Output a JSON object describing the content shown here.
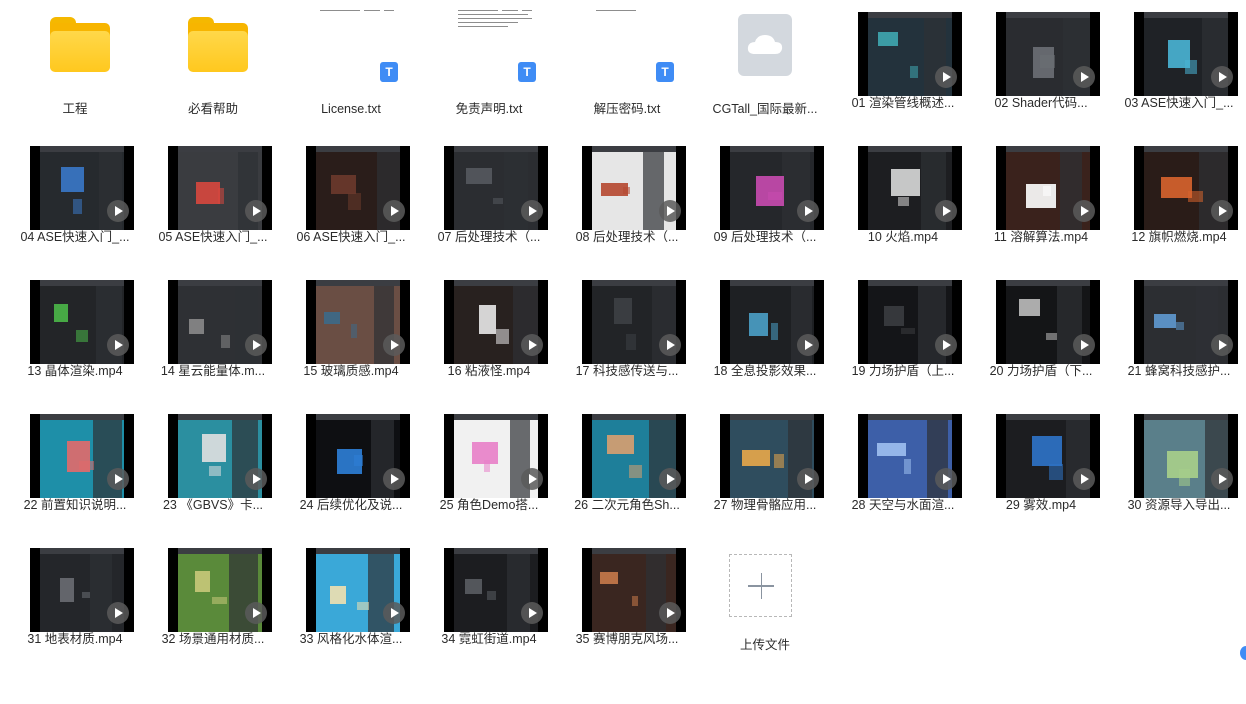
{
  "items": [
    {
      "label": "工程",
      "kind": "folder"
    },
    {
      "label": "必看帮助",
      "kind": "folder"
    },
    {
      "label": "License.txt",
      "kind": "text"
    },
    {
      "label": "免责声明.txt",
      "kind": "text"
    },
    {
      "label": "解压密码.txt",
      "kind": "text"
    },
    {
      "label": "CGTall_国际最新...",
      "kind": "cloud"
    },
    {
      "label": "01 渲染管线概述...",
      "kind": "video",
      "bg": "#23323c",
      "accent": "#3fa7b0"
    },
    {
      "label": "02 Shader代码...",
      "kind": "video",
      "bg": "#2a2c30",
      "accent": "#6c6f75"
    },
    {
      "label": "03 ASE快速入门_...",
      "kind": "video",
      "bg": "#1f2226",
      "accent": "#49b5d6"
    },
    {
      "label": "04 ASE快速入门_...",
      "kind": "video",
      "bg": "#262a2e",
      "accent": "#3a78c9"
    },
    {
      "label": "05 ASE快速入门_...",
      "kind": "video",
      "bg": "#3a3c40",
      "accent": "#d8473e"
    },
    {
      "label": "06 ASE快速入门_...",
      "kind": "video",
      "bg": "#2a1d1a",
      "accent": "#6b3a2c"
    },
    {
      "label": "07 后处理技术（...",
      "kind": "video",
      "bg": "#2b2d31",
      "accent": "#55595f"
    },
    {
      "label": "08 后处理技术（...",
      "kind": "video",
      "bg": "#e6e6e6",
      "accent": "#b5472f"
    },
    {
      "label": "09 后处理技术（...",
      "kind": "video",
      "bg": "#25272b",
      "accent": "#c94bb0"
    },
    {
      "label": "10 火焰.mp4",
      "kind": "video",
      "bg": "#1d1e21",
      "accent": "#d9d9d9"
    },
    {
      "label": "11 溶解算法.mp4",
      "kind": "video",
      "bg": "#3a221c",
      "accent": "#ffffff"
    },
    {
      "label": "12 旗帜燃烧.mp4",
      "kind": "video",
      "bg": "#2a1c18",
      "accent": "#d8642d"
    },
    {
      "label": "13 晶体渲染.mp4",
      "kind": "video",
      "bg": "#232528",
      "accent": "#4bb848"
    },
    {
      "label": "14 星云能量体.m...",
      "kind": "video",
      "bg": "#2e3034",
      "accent": "#8a8a8a"
    },
    {
      "label": "15 玻璃质感.mp4",
      "kind": "video",
      "bg": "#6a4e44",
      "accent": "#3c6a8a"
    },
    {
      "label": "16 粘液怪.mp4",
      "kind": "video",
      "bg": "#28211f",
      "accent": "#e8e8e8"
    },
    {
      "label": "17 科技感传送与...",
      "kind": "video",
      "bg": "#222427",
      "accent": "#3d4045"
    },
    {
      "label": "18 全息投影效果...",
      "kind": "video",
      "bg": "#1e2023",
      "accent": "#4aa0c8"
    },
    {
      "label": "19 力场护盾（上...",
      "kind": "video",
      "bg": "#141518",
      "accent": "#3a3c40"
    },
    {
      "label": "20 力场护盾（下...",
      "kind": "video",
      "bg": "#141517",
      "accent": "#bdbdbd"
    },
    {
      "label": "21 蜂窝科技感护...",
      "kind": "video",
      "bg": "#2c2e32",
      "accent": "#5f9ad1"
    },
    {
      "label": "22 前置知识说明...",
      "kind": "video",
      "bg": "#1e8fa8",
      "accent": "#e26a6a"
    },
    {
      "label": "23 《GBVS》卡...",
      "kind": "video",
      "bg": "#2b8fa0",
      "accent": "#e0e0e0"
    },
    {
      "label": "24 后续优化及说...",
      "kind": "video",
      "bg": "#0e0f12",
      "accent": "#2d7fd8"
    },
    {
      "label": "25 角色Demo搭...",
      "kind": "video",
      "bg": "#f1f1f1",
      "accent": "#e87fc8"
    },
    {
      "label": "26 二次元角色Sh...",
      "kind": "video",
      "bg": "#1e7f9a",
      "accent": "#d8a070"
    },
    {
      "label": "27 物理骨骼应用...",
      "kind": "video",
      "bg": "#2f4d5e",
      "accent": "#e9a84a"
    },
    {
      "label": "28 天空与水面渲...",
      "kind": "video",
      "bg": "#3d5fa8",
      "accent": "#9fc0ef"
    },
    {
      "label": "29 雾效.mp4",
      "kind": "video",
      "bg": "#1c1d20",
      "accent": "#2f74c9"
    },
    {
      "label": "30 资源导入导出...",
      "kind": "video",
      "bg": "#5a7f8a",
      "accent": "#a8d08a"
    },
    {
      "label": "31 地表材质.mp4",
      "kind": "video",
      "bg": "#24262a",
      "accent": "#6a6d72"
    },
    {
      "label": "32 场景通用材质...",
      "kind": "video",
      "bg": "#5a8a3a",
      "accent": "#c8c87a"
    },
    {
      "label": "33 风格化水体渲...",
      "kind": "video",
      "bg": "#3aa8d8",
      "accent": "#f1e0b0"
    },
    {
      "label": "34 霓虹街道.mp4",
      "kind": "video",
      "bg": "#1c1d20",
      "accent": "#5a5d62"
    },
    {
      "label": "35 赛博朋克风场...",
      "kind": "video",
      "bg": "#3a2620",
      "accent": "#c87a4a"
    },
    {
      "label": "上传文件",
      "kind": "upload"
    }
  ]
}
